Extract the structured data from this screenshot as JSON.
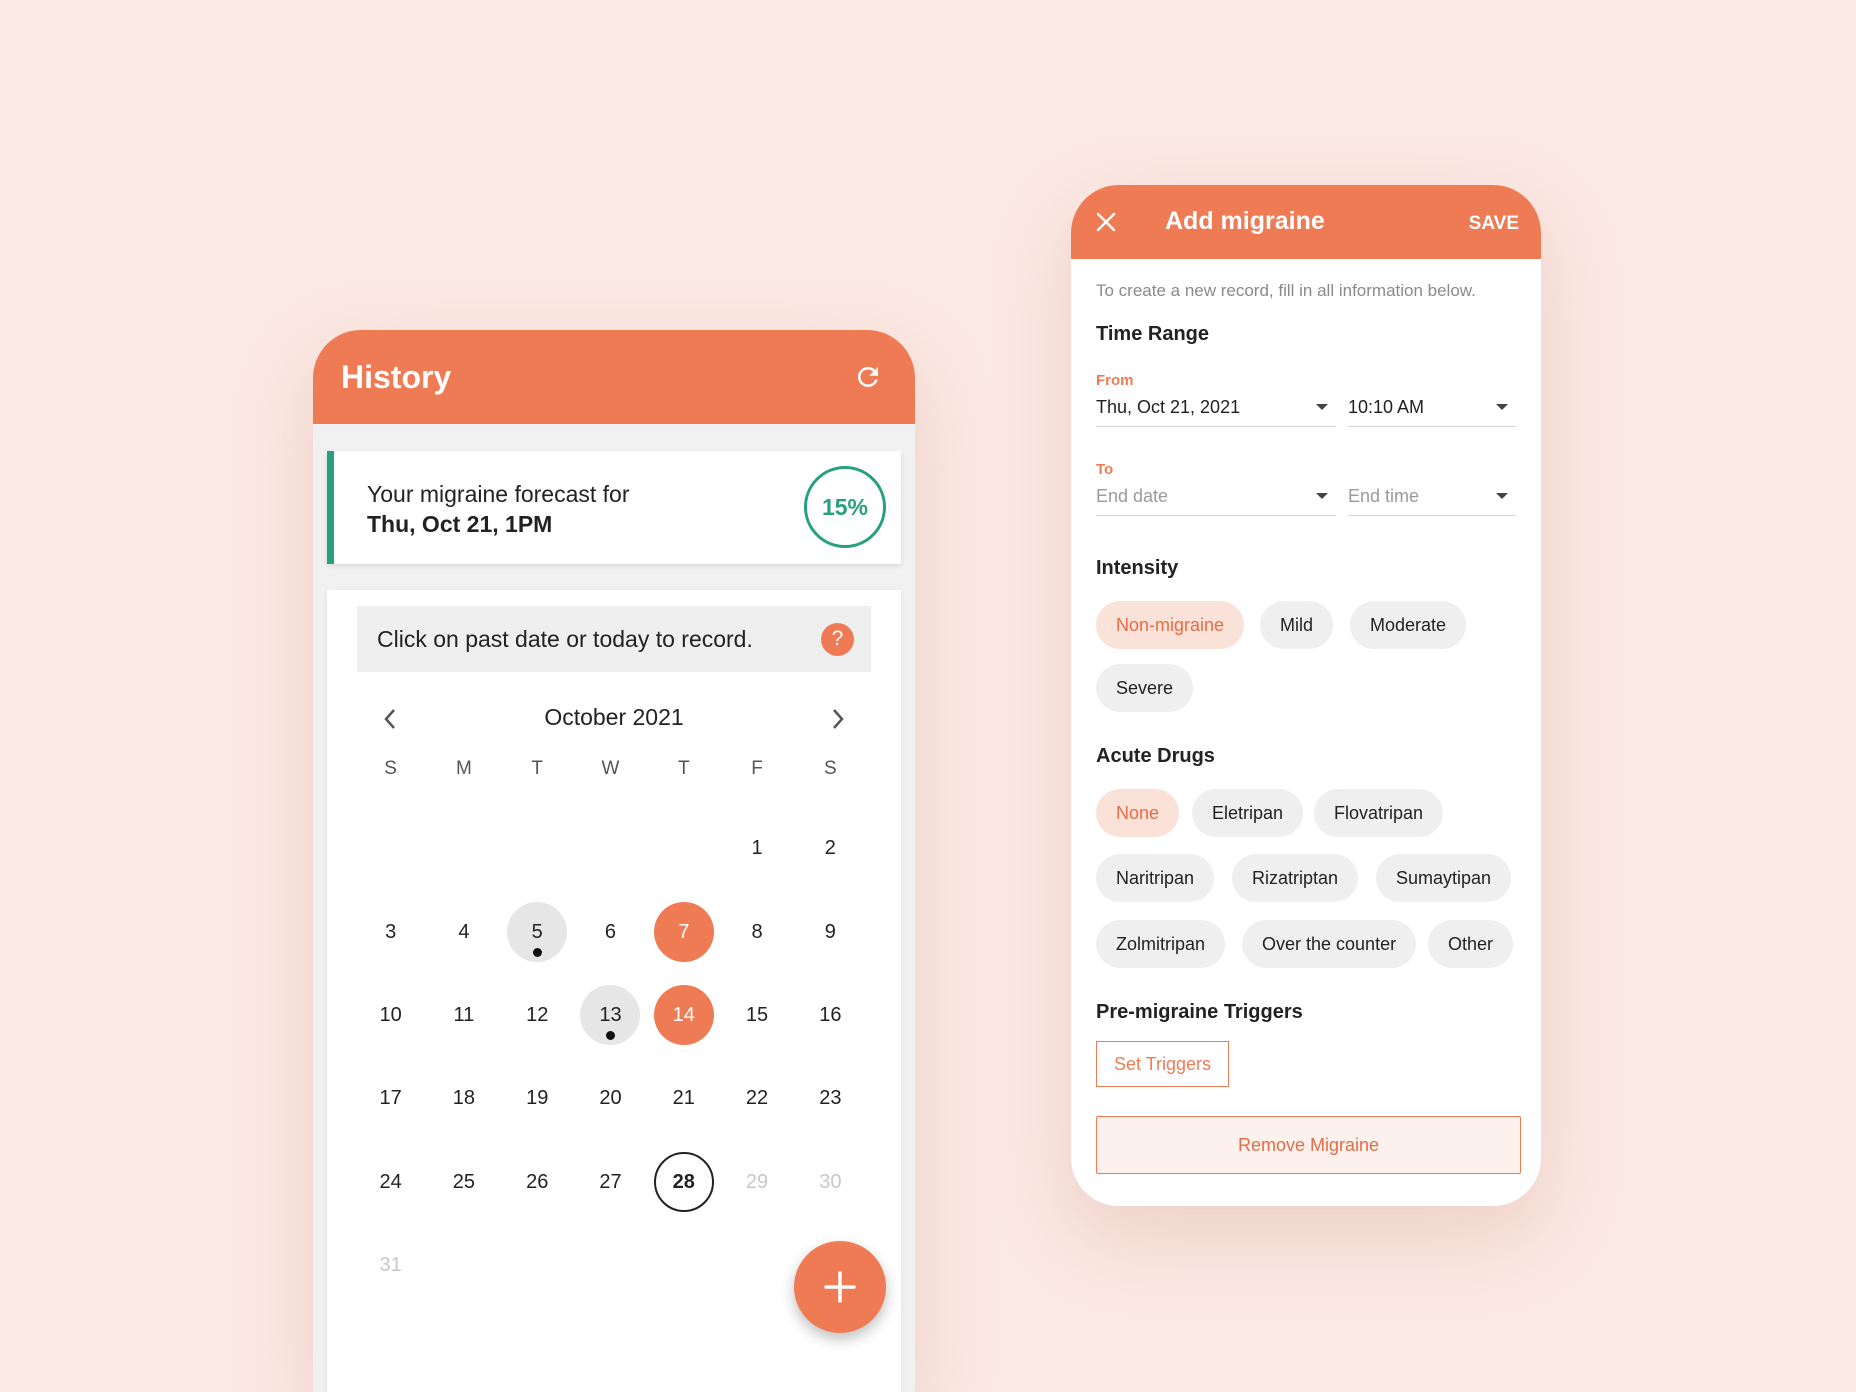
{
  "history": {
    "title": "History",
    "forecast": {
      "line1": "Your migraine forecast for",
      "line2": "Thu, Oct 21, 1PM",
      "percent": "15%"
    },
    "hint": "Click on past date or today to record.",
    "help": "?",
    "month": "October 2021",
    "weekdays": [
      "S",
      "M",
      "T",
      "W",
      "T",
      "F",
      "S"
    ],
    "weeks": [
      [
        "",
        "",
        "",
        "",
        "",
        "1",
        "2"
      ],
      [
        "3",
        "4",
        "5",
        "6",
        "7",
        "8",
        "9"
      ],
      [
        "10",
        "11",
        "12",
        "13",
        "14",
        "15",
        "16"
      ],
      [
        "17",
        "18",
        "19",
        "20",
        "21",
        "22",
        "23"
      ],
      [
        "24",
        "25",
        "26",
        "27",
        "28",
        "29",
        "30"
      ],
      [
        "31",
        "",
        "",
        "",
        "",
        "",
        ""
      ]
    ],
    "gray_days": [
      "5",
      "13"
    ],
    "orange_days": [
      "7",
      "14"
    ],
    "dot_days": [
      "5",
      "13"
    ],
    "today": "28",
    "future_days": [
      "29",
      "30",
      "31"
    ],
    "fab_icon": "plus-icon"
  },
  "add_migraine": {
    "title": "Add migraine",
    "save": "SAVE",
    "intro": "To create a new record, fill in all information below.",
    "time_range": {
      "title": "Time Range",
      "from_label": "From",
      "from_date": "Thu, Oct 21, 2021",
      "from_time": "10:10 AM",
      "to_label": "To",
      "to_date_placeholder": "End date",
      "to_time_placeholder": "End time"
    },
    "intensity": {
      "title": "Intensity",
      "options": [
        "Non-migraine",
        "Mild",
        "Moderate",
        "Severe"
      ],
      "selected": "Non-migraine"
    },
    "acute_drugs": {
      "title": "Acute Drugs",
      "options": [
        "None",
        "Eletripan",
        "Flovatripan",
        "Naritripan",
        "Rizatriptan",
        "Sumaytipan",
        "Zolmitripan",
        "Over the counter",
        "Other"
      ],
      "selected": "None"
    },
    "triggers": {
      "title": "Pre-migraine Triggers",
      "button": "Set Triggers"
    },
    "remove": "Remove Migraine"
  },
  "colors": {
    "accent": "#ef7b55",
    "forecast": "#26a07e",
    "background": "#fbe9e3"
  }
}
